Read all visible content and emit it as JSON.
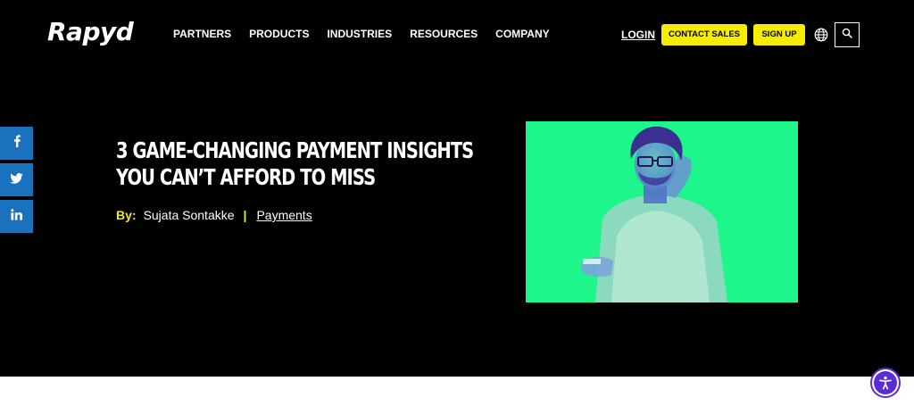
{
  "colors": {
    "background": "#000000",
    "accent": "#f5ec00",
    "social": "#1a72bf",
    "image_tint": "#1ef58b",
    "accessibility": "#5b2bd6"
  },
  "header": {
    "logo": "Rapyd",
    "nav": [
      "PARTNERS",
      "PRODUCTS",
      "INDUSTRIES",
      "RESOURCES",
      "COMPANY"
    ],
    "login": "LOGIN",
    "contact_sales": "CONTACT SALES",
    "sign_up": "SIGN UP",
    "icons": [
      "globe-icon",
      "search-icon"
    ]
  },
  "social": {
    "icons": [
      "facebook-icon",
      "twitter-icon",
      "linkedin-icon"
    ]
  },
  "article": {
    "title_lines": [
      "3 GAME-CHANGING PAYMENT INSIGHTS",
      "YOU CAN’T AFFORD TO MISS"
    ],
    "by_label": "By:",
    "author": "Sujata Sontakke",
    "separator": "|",
    "category": "Payments"
  },
  "accessibility": {
    "icon": "accessibility-icon"
  }
}
